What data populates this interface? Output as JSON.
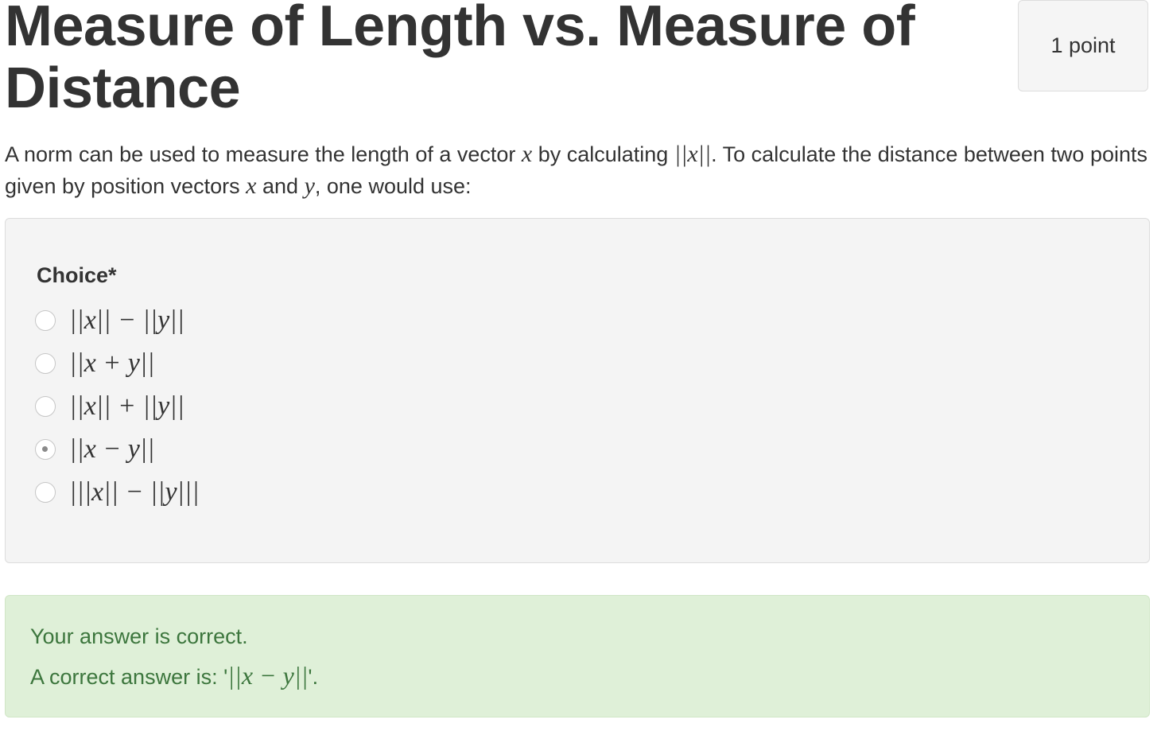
{
  "question": {
    "title": "Measure of Length vs. Measure of Distance",
    "points": "1 point",
    "prompt_part1": "A norm can be used to measure the length of a vector ",
    "var_x": "x",
    "prompt_part2": " by calculating ",
    "norm_x": "||x||",
    "prompt_part3": ". To calculate the distance between two points given by position vectors ",
    "var_x2": "x",
    "prompt_part4": " and ",
    "var_y": "y",
    "prompt_part5": ", one would use:"
  },
  "choice": {
    "label": "Choice*",
    "options": [
      {
        "text": "||x|| − ||y||",
        "selected": false
      },
      {
        "text": "||x + y||",
        "selected": false
      },
      {
        "text": "||x|| + ||y||",
        "selected": false
      },
      {
        "text": "||x − y||",
        "selected": true
      },
      {
        "text": "|||x|| − ||y|||",
        "selected": false
      }
    ]
  },
  "feedback": {
    "status": "Your answer is correct.",
    "answer_prefix": "A correct answer is: '",
    "answer_math": "||x − y||",
    "answer_suffix": "'.",
    "color_text": "#3c763d",
    "color_bg": "#dff0d8"
  }
}
